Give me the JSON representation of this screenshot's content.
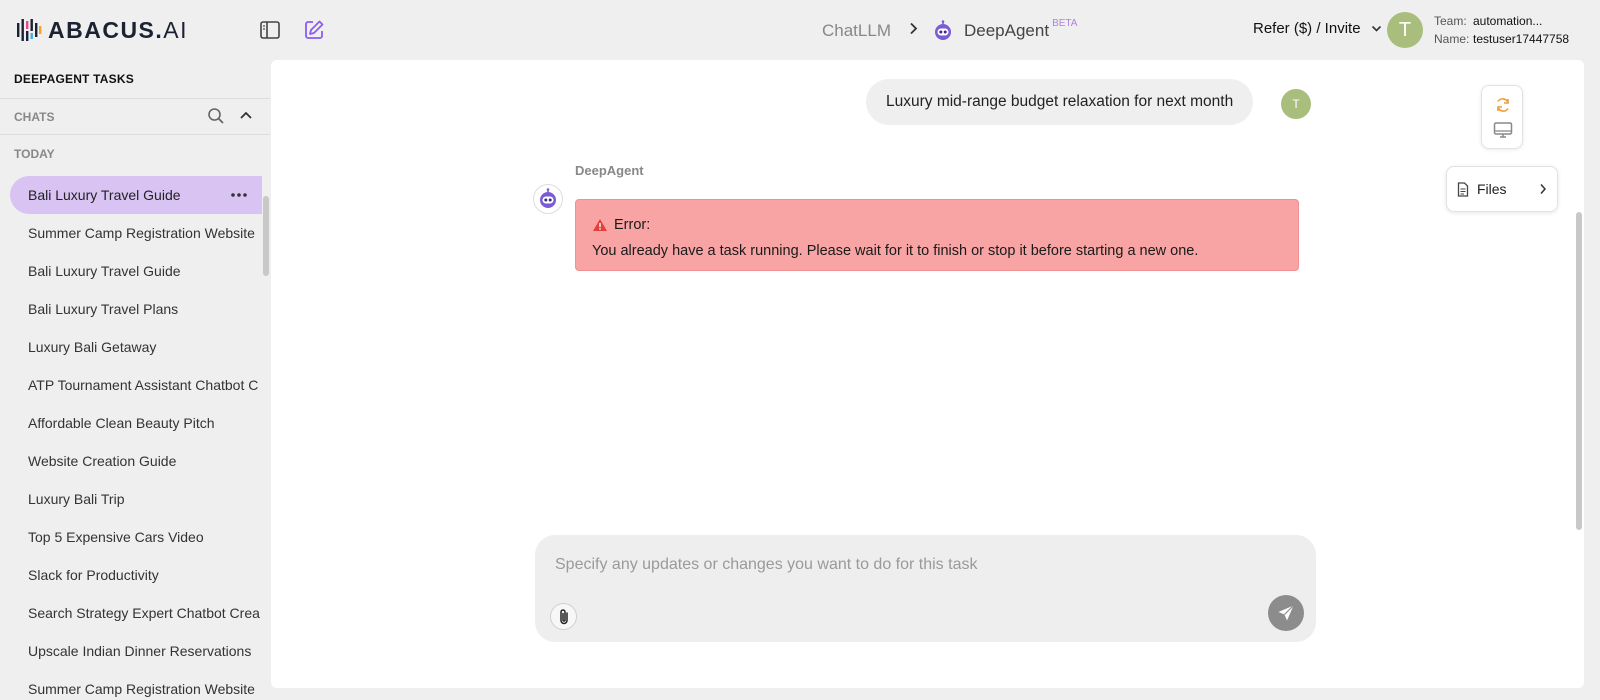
{
  "header": {
    "logo_text": "ABACUS.",
    "logo_suffix": "AI",
    "breadcrumb": {
      "root": "ChatLLM",
      "current": "DeepAgent",
      "badge": "BETA"
    },
    "refer_label": "Refer ($) / Invite",
    "avatar_initial": "T",
    "team_key": "Team:",
    "team_value": "automation...",
    "name_key": "Name:",
    "name_value": "testuser17447758"
  },
  "sidebar": {
    "title": "DEEPAGENT TASKS",
    "chats_label": "CHATS",
    "today_label": "TODAY",
    "items": [
      {
        "label": "Bali Luxury Travel Guide",
        "active": true
      },
      {
        "label": "Summer Camp Registration Website"
      },
      {
        "label": "Bali Luxury Travel Guide"
      },
      {
        "label": "Bali Luxury Travel Plans"
      },
      {
        "label": "Luxury Bali Getaway"
      },
      {
        "label": "ATP Tournament Assistant Chatbot C"
      },
      {
        "label": "Affordable Clean Beauty Pitch"
      },
      {
        "label": "Website Creation Guide"
      },
      {
        "label": "Luxury Bali Trip"
      },
      {
        "label": "Top 5 Expensive Cars Video"
      },
      {
        "label": "Slack for Productivity"
      },
      {
        "label": "Search Strategy Expert Chatbot Crea"
      },
      {
        "label": "Upscale Indian Dinner Reservations"
      },
      {
        "label": "Summer Camp Registration Website"
      }
    ]
  },
  "conversation": {
    "user_message": "Luxury mid-range budget relaxation for next month",
    "user_avatar_initial": "T",
    "agent_name": "DeepAgent",
    "error_title": "Error:",
    "error_text": "You already have a task running. Please wait for it to finish or stop it before starting a new one."
  },
  "side_panel": {
    "files_label": "Files"
  },
  "composer": {
    "placeholder": "Specify any updates or changes you want to do for this task",
    "value": ""
  },
  "colors": {
    "accent_purple": "#8b5cf6",
    "active_item": "#d8c3f3",
    "error_bg": "#f9a4a4",
    "avatar_green": "#a9bd7c"
  }
}
